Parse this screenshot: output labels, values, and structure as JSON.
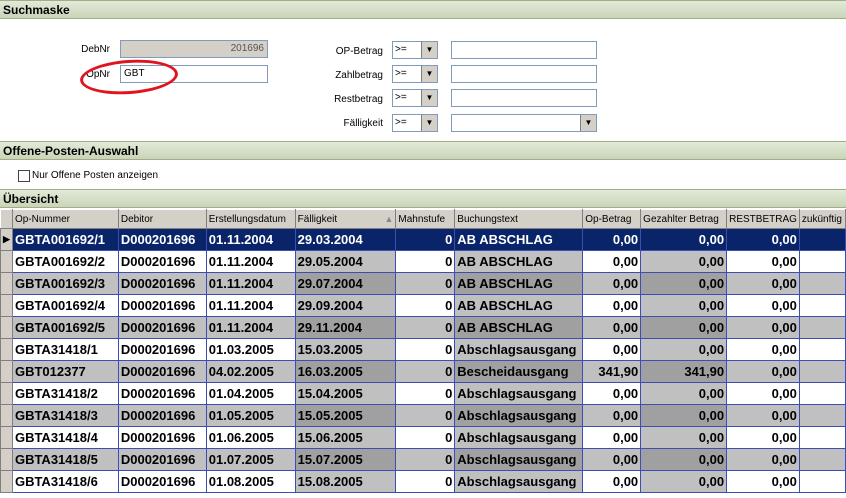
{
  "sections": {
    "search": "Suchmaske",
    "open_items": "Offene-Posten-Auswahl",
    "overview": "Übersicht"
  },
  "form": {
    "debnr_label": "DebNr",
    "debnr_value": "201696",
    "opnr_label": "OpNr",
    "opnr_value": "GBT",
    "op_betrag_label": "OP-Betrag",
    "zahlbetrag_label": "Zahlbetrag",
    "restbetrag_label": "Restbetrag",
    "faelligkeit_label": "Fälligkeit",
    "operator": ">="
  },
  "checkbox": {
    "label": "Nur Offene Posten anzeigen",
    "checked": false
  },
  "table": {
    "columns": [
      "Op-Nummer",
      "Debitor",
      "Erstellungsdatum",
      "Fälligkeit",
      "Mahnstufe",
      "Buchungstext",
      "Op-Betrag",
      "Gezahlter Betrag",
      "RESTBETRAG",
      "zukünftig"
    ],
    "sort_indicator": "▲",
    "rows": [
      [
        "GBTA001692/1",
        "D000201696",
        "01.11.2004",
        "29.03.2004",
        "0",
        "AB ABSCHLAG",
        "0,00",
        "0,00",
        "0,00"
      ],
      [
        "GBTA001692/2",
        "D000201696",
        "01.11.2004",
        "29.05.2004",
        "0",
        "AB ABSCHLAG",
        "0,00",
        "0,00",
        "0,00"
      ],
      [
        "GBTA001692/3",
        "D000201696",
        "01.11.2004",
        "29.07.2004",
        "0",
        "AB ABSCHLAG",
        "0,00",
        "0,00",
        "0,00"
      ],
      [
        "GBTA001692/4",
        "D000201696",
        "01.11.2004",
        "29.09.2004",
        "0",
        "AB ABSCHLAG",
        "0,00",
        "0,00",
        "0,00"
      ],
      [
        "GBTA001692/5",
        "D000201696",
        "01.11.2004",
        "29.11.2004",
        "0",
        "AB ABSCHLAG",
        "0,00",
        "0,00",
        "0,00"
      ],
      [
        "GBTA31418/1",
        "D000201696",
        "01.03.2005",
        "15.03.2005",
        "0",
        "Abschlagsausgang",
        "0,00",
        "0,00",
        "0,00"
      ],
      [
        "GBT012377",
        "D000201696",
        "04.02.2005",
        "16.03.2005",
        "0",
        "Bescheidausgang",
        "341,90",
        "341,90",
        "0,00"
      ],
      [
        "GBTA31418/2",
        "D000201696",
        "01.04.2005",
        "15.04.2005",
        "0",
        "Abschlagsausgang",
        "0,00",
        "0,00",
        "0,00"
      ],
      [
        "GBTA31418/3",
        "D000201696",
        "01.05.2005",
        "15.05.2005",
        "0",
        "Abschlagsausgang",
        "0,00",
        "0,00",
        "0,00"
      ],
      [
        "GBTA31418/4",
        "D000201696",
        "01.06.2005",
        "15.06.2005",
        "0",
        "Abschlagsausgang",
        "0,00",
        "0,00",
        "0,00"
      ],
      [
        "GBTA31418/5",
        "D000201696",
        "01.07.2005",
        "15.07.2005",
        "0",
        "Abschlagsausgang",
        "0,00",
        "0,00",
        "0,00"
      ],
      [
        "GBTA31418/6",
        "D000201696",
        "01.08.2005",
        "15.08.2005",
        "0",
        "Abschlagsausgang",
        "0,00",
        "0,00",
        "0,00"
      ]
    ]
  },
  "icons": {
    "row_pointer": "row-pointer-icon",
    "dropdown": "chevron-down-icon"
  },
  "colors": {
    "selection": "#0a246a",
    "annotation": "#e0141e",
    "grid_line": "#3c4fb0"
  }
}
